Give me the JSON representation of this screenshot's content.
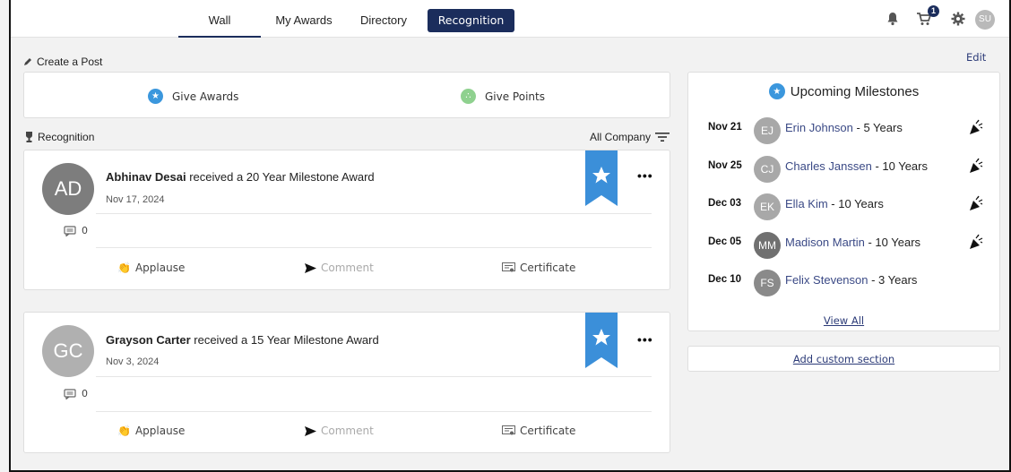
{
  "nav": {
    "tabs": [
      {
        "label": "Wall"
      },
      {
        "label": "My Awards"
      },
      {
        "label": "Directory"
      },
      {
        "label": "Recognition"
      }
    ],
    "cart_count": "1",
    "user_initials": "SU"
  },
  "create_post": {
    "label": "Create a Post"
  },
  "edit_label": "Edit",
  "give": {
    "awards_label": "Give Awards",
    "points_label": "Give Points"
  },
  "recognition": {
    "label": "Recognition",
    "filter_label": "All Company"
  },
  "posts": [
    {
      "initials": "AD",
      "name": "Abhinav Desai",
      "text": " received a 20 Year Milestone Award",
      "date": "Nov 17, 2024",
      "comments": "0",
      "more": "•••",
      "actions": {
        "applause": "Applause",
        "comment": "Comment",
        "certificate": "Certificate"
      }
    },
    {
      "initials": "GC",
      "name": "Grayson Carter",
      "text": " received a 15 Year Milestone Award",
      "date": "Nov 3, 2024",
      "comments": "0",
      "more": "•••",
      "actions": {
        "applause": "Applause",
        "comment": "Comment",
        "certificate": "Certificate"
      }
    }
  ],
  "milestones": {
    "title": "Upcoming Milestones",
    "items": [
      {
        "date": "Nov 21",
        "initials": "EJ",
        "name": "Erin Johnson",
        "years": " - 5 Years"
      },
      {
        "date": "Nov 25",
        "initials": "CJ",
        "name": "Charles Janssen",
        "years": " - 10 Years"
      },
      {
        "date": "Dec 03",
        "initials": "EK",
        "name": "Ella Kim",
        "years": " - 10 Years"
      },
      {
        "date": "Dec 05",
        "initials": "MM",
        "name": "Madison Martin",
        "years": " - 10 Years"
      },
      {
        "date": "Dec 10",
        "initials": "FS",
        "name": "Felix Stevenson",
        "years": " - 3 Years"
      }
    ],
    "view_all": "View All"
  },
  "custom_section": {
    "label": "Add custom section"
  },
  "colors": {
    "brand": "#1b2d5c",
    "award_blue": "#3b97dd",
    "points_green": "#8fd18f",
    "avatar_gray": "#a8a8a8",
    "avatar_dark": "#7a7a7a"
  }
}
